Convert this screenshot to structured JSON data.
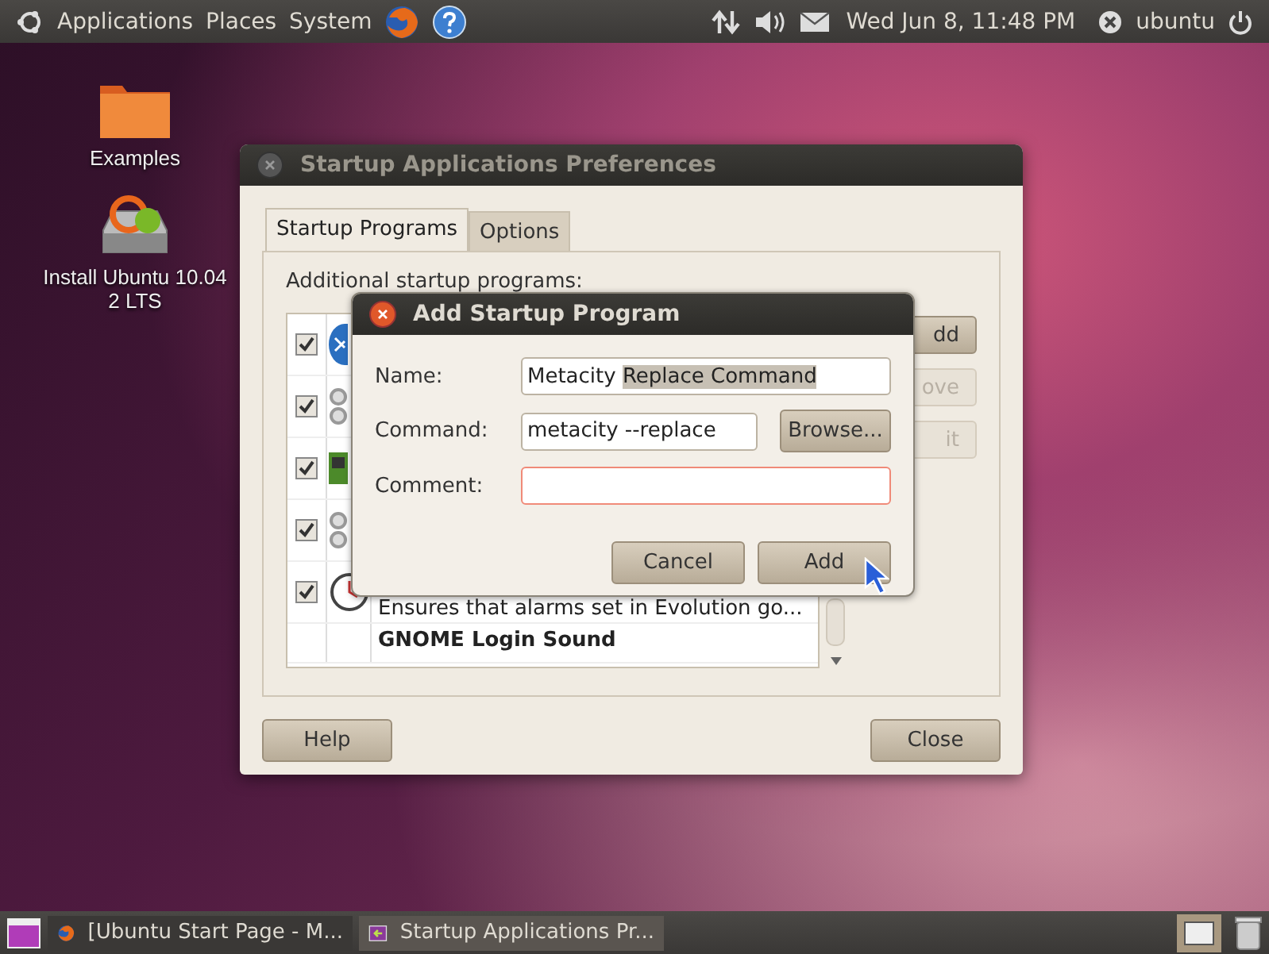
{
  "top_panel": {
    "menus": [
      "Applications",
      "Places",
      "System"
    ],
    "clock": "Wed Jun  8, 11:48 PM",
    "user": "ubuntu"
  },
  "desktop_icons": [
    {
      "kind": "folder",
      "lines": [
        "Examples"
      ]
    },
    {
      "kind": "installer",
      "lines": [
        "Install Ubuntu 10.04",
        "2 LTS"
      ]
    }
  ],
  "main_window": {
    "title": "Startup Applications Preferences",
    "tabs": [
      {
        "label": "Startup Programs",
        "selected": true
      },
      {
        "label": "Options",
        "selected": false
      }
    ],
    "list_label": "Additional startup programs:",
    "programs": [
      {
        "kind": "bluetooth",
        "checked": true
      },
      {
        "kind": "gears",
        "checked": true
      },
      {
        "kind": "board",
        "checked": true
      },
      {
        "kind": "gears",
        "checked": true
      },
      {
        "kind": "clock",
        "checked": true,
        "description": "Ensures that alarms set in Evolution go..."
      },
      {
        "name": "GNOME Login Sound"
      }
    ],
    "side_buttons": [
      {
        "label": "dd",
        "disabled": false
      },
      {
        "label": "ove",
        "disabled": true
      },
      {
        "label": "it",
        "disabled": true
      }
    ],
    "buttons": [
      "Help",
      "Close"
    ]
  },
  "dialog": {
    "title": "Add Startup Program",
    "fields": [
      {
        "label": "Name:",
        "value": "Metacity ",
        "selected_text": "Replace Command",
        "focused": false
      },
      {
        "label": "Command:",
        "value": "metacity --replace",
        "focused": false,
        "browse": "Browse..."
      },
      {
        "label": "Comment:",
        "focused": true
      }
    ],
    "buttons": [
      "Cancel",
      "Add"
    ]
  },
  "taskbar": {
    "items": [
      {
        "kind": "firefox",
        "label": "[Ubuntu Start Page - M...",
        "selected": false
      },
      {
        "kind": "startup",
        "label": "Startup Applications Pr...",
        "selected": true
      }
    ]
  }
}
